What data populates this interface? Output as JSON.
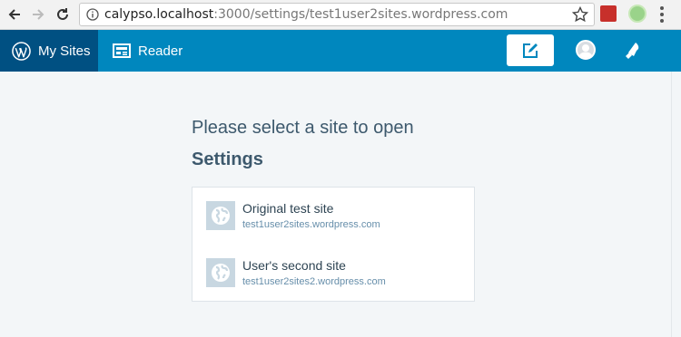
{
  "browser": {
    "url_host": "calypso.localhost",
    "url_path": ":3000/settings/test1user2sites.wordpress.com"
  },
  "masterbar": {
    "my_sites_label": "My Sites",
    "reader_label": "Reader",
    "accent_color": "#0087be",
    "active_color": "#005082"
  },
  "page": {
    "title_line1": "Please select a site to open",
    "title_line2": "Settings"
  },
  "sites": [
    {
      "name": "Original test site",
      "url": "test1user2sites.wordpress.com"
    },
    {
      "name": "User's second site",
      "url": "test1user2sites2.wordpress.com"
    }
  ]
}
